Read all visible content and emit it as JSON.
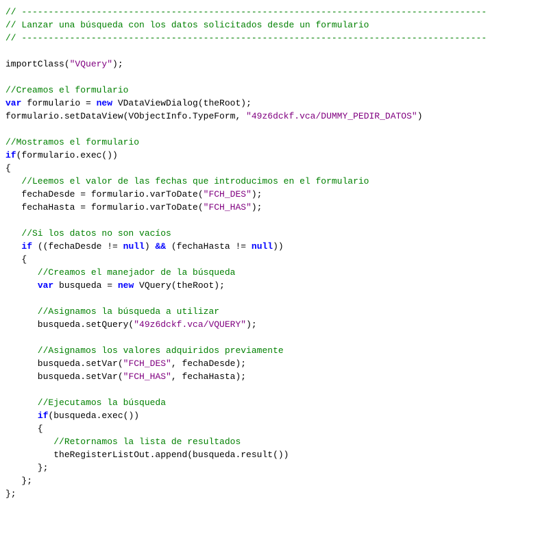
{
  "code": {
    "l1": "// ---------------------------------------------------------------------------------------",
    "l2": "// Lanzar una búsqueda con los datos solicitados desde un formulario",
    "l3": "// ---------------------------------------------------------------------------------------",
    "l4": "",
    "l5_a": "importClass(",
    "l5_b": "\"VQuery\"",
    "l5_c": ");",
    "l6": "",
    "l7": "//Creamos el formulario",
    "l8_a": "var",
    "l8_b": " formulario = ",
    "l8_c": "new",
    "l8_d": " VDataViewDialog(theRoot);",
    "l9_a": "formulario.setDataView(VObjectInfo.TypeForm, ",
    "l9_b": "\"49z6dckf.vca/DUMMY_PEDIR_DATOS\"",
    "l9_c": ")",
    "l10": "",
    "l11": "//Mostramos el formulario",
    "l12_a": "if",
    "l12_b": "(formulario.exec())",
    "l13": "{",
    "l14": "   //Leemos el valor de las fechas que introducimos en el formulario",
    "l15_a": "   fechaDesde = formulario.varToDate(",
    "l15_b": "\"FCH_DES\"",
    "l15_c": ");",
    "l16_a": "   fechaHasta = formulario.varToDate(",
    "l16_b": "\"FCH_HAS\"",
    "l16_c": ");",
    "l17": "",
    "l18": "   //Si los datos no son vacíos",
    "l19_a": "   ",
    "l19_b": "if",
    "l19_c": " ((fechaDesde != ",
    "l19_d": "null",
    "l19_e": ") ",
    "l19_f": "&&",
    "l19_g": " (fechaHasta != ",
    "l19_h": "null",
    "l19_i": "))",
    "l20": "   {",
    "l21": "      //Creamos el manejador de la búsqueda",
    "l22_a": "      ",
    "l22_b": "var",
    "l22_c": " busqueda = ",
    "l22_d": "new",
    "l22_e": " VQuery(theRoot);",
    "l23": "",
    "l24": "      //Asignamos la búsqueda a utilizar",
    "l25_a": "      busqueda.setQuery(",
    "l25_b": "\"49z6dckf.vca/VQUERY\"",
    "l25_c": ");",
    "l26": "",
    "l27": "      //Asignamos los valores adquiridos previamente",
    "l28_a": "      busqueda.setVar(",
    "l28_b": "\"FCH_DES\"",
    "l28_c": ", fechaDesde);",
    "l29_a": "      busqueda.setVar(",
    "l29_b": "\"FCH_HAS\"",
    "l29_c": ", fechaHasta);",
    "l30": "",
    "l31": "      //Ejecutamos la búsqueda",
    "l32_a": "      ",
    "l32_b": "if",
    "l32_c": "(busqueda.exec())",
    "l33": "      {",
    "l34": "         //Retornamos la lista de resultados",
    "l35": "         theRegisterListOut.append(busqueda.result())",
    "l36": "      };",
    "l37": "   };",
    "l38": "};"
  }
}
